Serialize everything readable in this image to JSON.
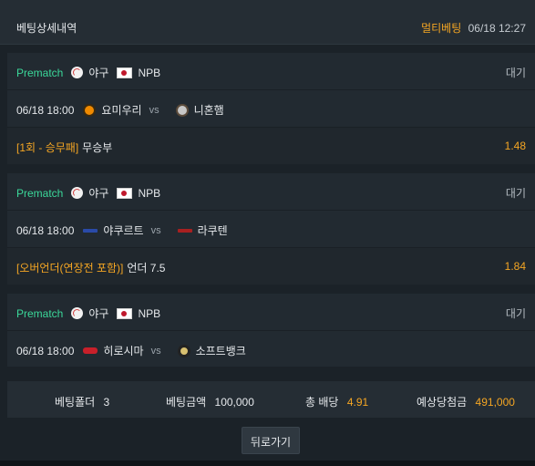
{
  "header": {
    "title": "베팅상세내역",
    "tag": "멀티베팅",
    "datetime": "06/18 12:27"
  },
  "colors": {
    "accent": "#f5a623",
    "prematch": "#3bd89a"
  },
  "cards": [
    {
      "mode": "Prematch",
      "sport": "야구",
      "league": "NPB",
      "status": "대기",
      "match_time": "06/18 18:00",
      "home": "요미우리",
      "vs": "vs",
      "away": "니혼햄",
      "bet_label": "[1회 - 승무패]",
      "pick": "무승부",
      "odds": "1.48"
    },
    {
      "mode": "Prematch",
      "sport": "야구",
      "league": "NPB",
      "status": "대기",
      "match_time": "06/18 18:00",
      "home": "야쿠르트",
      "vs": "vs",
      "away": "라쿠텐",
      "bet_label": "[오버언더(연장전 포함)]",
      "pick": "언더 7.5",
      "odds": "1.84"
    },
    {
      "mode": "Prematch",
      "sport": "야구",
      "league": "NPB",
      "status": "대기",
      "match_time": "06/18 18:00",
      "home": "히로시마",
      "vs": "vs",
      "away": "소프트뱅크"
    }
  ],
  "summary": {
    "folder_label": "베팅폴더",
    "folder_value": "3",
    "amount_label": "베팅금액",
    "amount_value": "100,000",
    "odds_label": "총 배당",
    "odds_value": "4.91",
    "expected_label": "예상당첨금",
    "expected_value": "491,000"
  },
  "back_button": "뒤로가기"
}
